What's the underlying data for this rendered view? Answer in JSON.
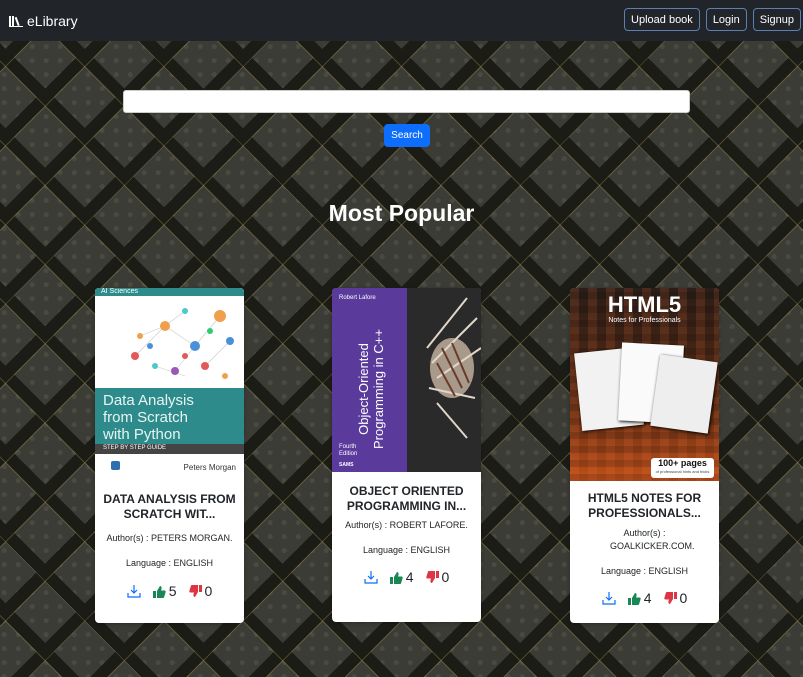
{
  "navbar": {
    "brand": "eLibrary",
    "buttons": {
      "upload": "Upload book",
      "login": "Login",
      "signup": "Signup"
    }
  },
  "search": {
    "value": "",
    "placeholder": "",
    "button": "Search"
  },
  "section_title": "Most Popular",
  "books": [
    {
      "title": "DATA ANALYSIS FROM SCRATCH WIT...",
      "authors": "Author(s) : PETERS MORGAN.",
      "language": "Language : ENGLISH",
      "likes": "5",
      "dislikes": "0",
      "cover": {
        "series": "AI Sciences",
        "title_lines": [
          "Data Analysis",
          "from Scratch",
          "with Python"
        ],
        "tagline": "STEP BY STEP GUIDE",
        "author": "Peters Morgan"
      }
    },
    {
      "title": "OBJECT ORIENTED PROGRAMMING IN...",
      "authors": "Author(s) : ROBERT LAFORE.",
      "language": "Language : ENGLISH",
      "likes": "4",
      "dislikes": "0",
      "cover": {
        "author": "Robert Lafore",
        "title_lines": [
          "Object-Oriented",
          "Programming in C++"
        ],
        "edition_lines": [
          "Fourth",
          "Edition"
        ],
        "publisher": "SAMS"
      }
    },
    {
      "title": "HTML5 NOTES FOR PROFESSIONALS...",
      "authors": "Author(s) : GOALKICKER.COM.",
      "language": "Language : ENGLISH",
      "likes": "4",
      "dislikes": "0",
      "cover": {
        "title": "HTML5",
        "subtitle": "Notes for Professionals",
        "pages": "100+ pages",
        "pages_sub": "of professional hints and tricks"
      }
    }
  ],
  "colors": {
    "navbar": "#212529",
    "primary": "#0d6efd",
    "like": "#198754",
    "dislike": "#dc3545"
  }
}
